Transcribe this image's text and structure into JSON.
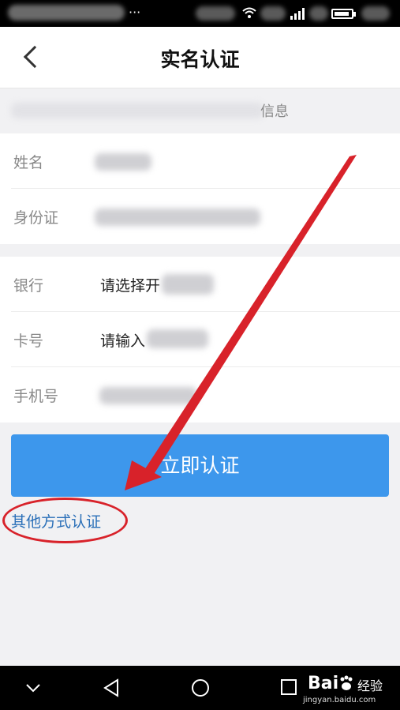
{
  "status_bar": {
    "overflow_dots": "···"
  },
  "header": {
    "title": "实名认证"
  },
  "notice": {
    "text_end": "信息"
  },
  "identity_section": {
    "rows": [
      {
        "label": "姓名"
      },
      {
        "label": "身份证"
      }
    ]
  },
  "bank_section": {
    "rows": [
      {
        "label": "银行",
        "value": "请选择开"
      },
      {
        "label": "卡号",
        "value": "请输入"
      },
      {
        "label": "手机号"
      }
    ]
  },
  "actions": {
    "submit_label": "立即认证",
    "other_method_link": "其他方式认证"
  },
  "watermark": {
    "brand": "Bai",
    "brand_cn": "经验",
    "url": "jingyan.baidu.com"
  },
  "colors": {
    "accent": "#3d97ec",
    "link": "#2a6fb8",
    "annotation": "#d8222a"
  },
  "icons": [
    "back-arrow-icon",
    "wifi-icon",
    "signal-icon",
    "battery-icon",
    "nav-down-icon",
    "nav-back-icon",
    "nav-home-icon",
    "nav-recents-icon"
  ]
}
